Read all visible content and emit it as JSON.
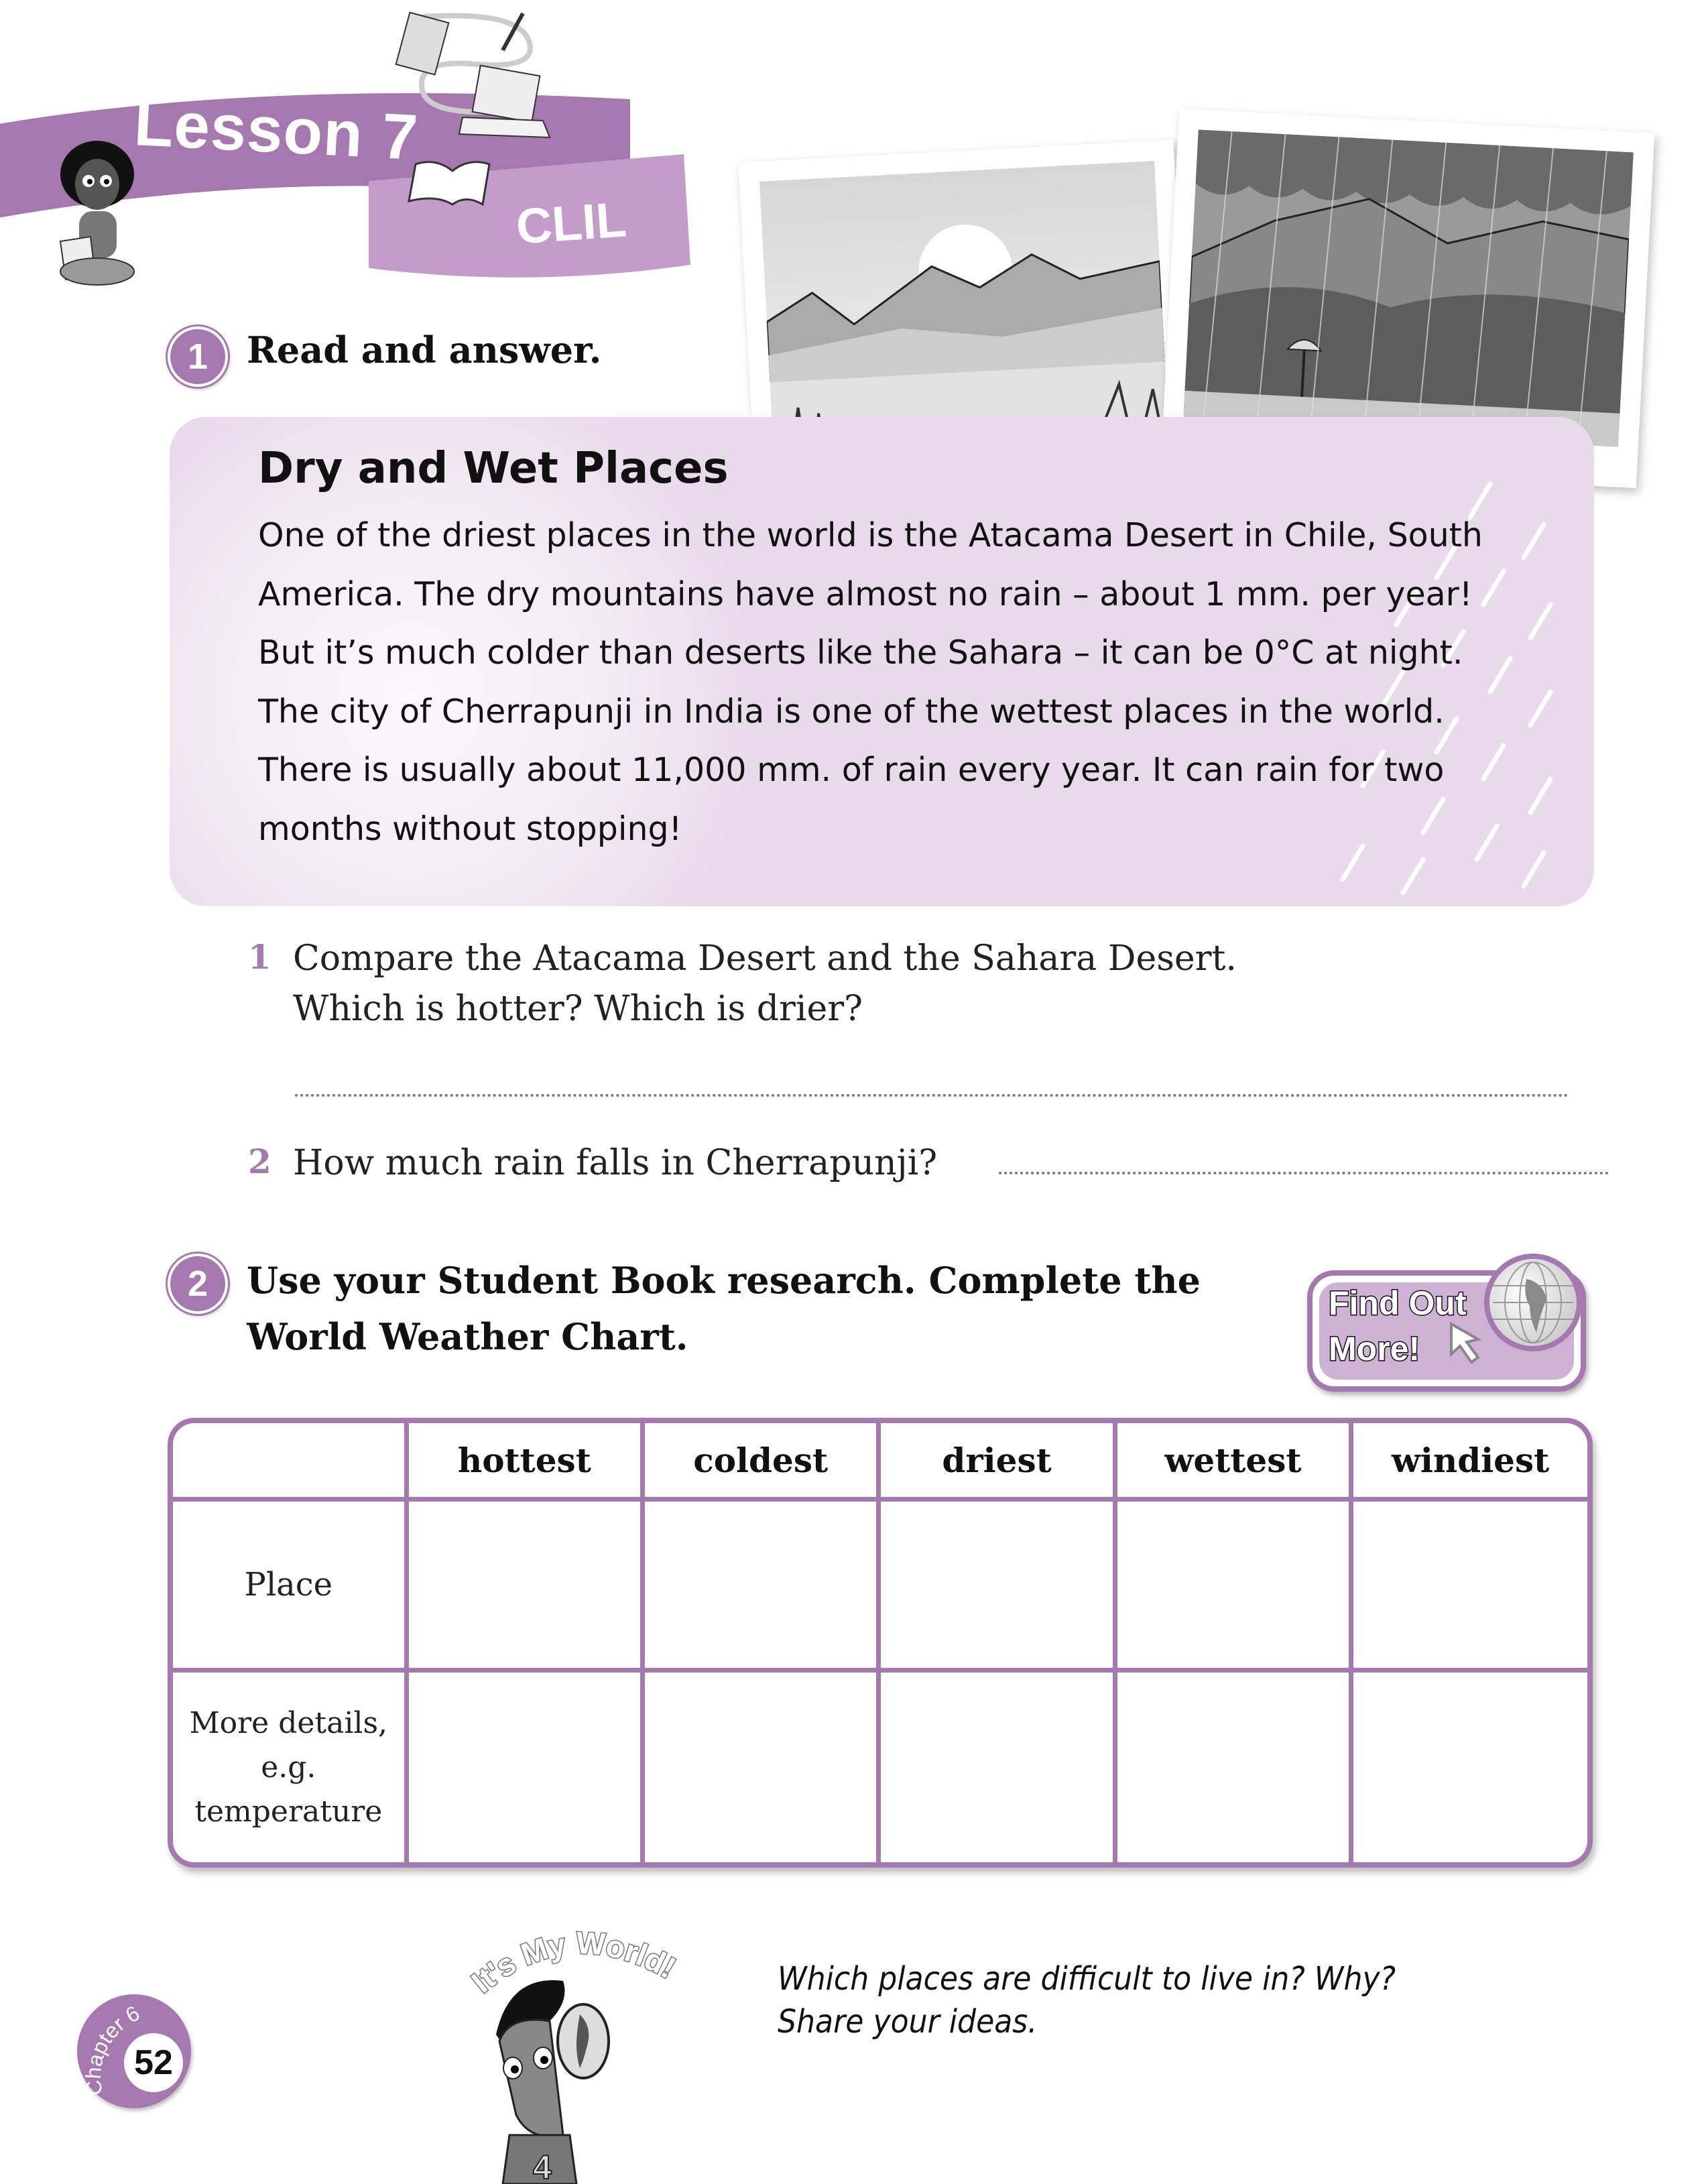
{
  "header": {
    "lesson_label": "Lesson 7",
    "section_label": "CLIL"
  },
  "exercise1": {
    "number": "1",
    "instruction": "Read and answer."
  },
  "reading": {
    "title": "Dry and Wet Places",
    "lines": [
      "One of the driest places in the world is the Atacama Desert in Chile, South",
      "America. The dry mountains have almost no rain – about 1 mm. per year!",
      "But it’s much colder than deserts like the Sahara – it can be 0°C at night.",
      "The city of Cherrapunji in India is one of the wettest places in the world.",
      "There is usually about 11,000 mm. of rain every year. It can rain for two",
      "months without stopping!"
    ]
  },
  "photos": [
    {
      "subject": "dry desert mountains"
    },
    {
      "subject": "rainy mountain forest with person under umbrella"
    }
  ],
  "questions": [
    {
      "number": "1",
      "lines": [
        "Compare the Atacama Desert and the Sahara Desert.",
        "Which is hotter? Which is drier?"
      ],
      "answer": ""
    },
    {
      "number": "2",
      "lines": [
        "How much rain falls in Cherrapunji?"
      ],
      "answer": ""
    }
  ],
  "exercise2": {
    "number": "2",
    "instruction_lines": [
      "Use your Student Book research. Complete the",
      "World Weather Chart."
    ]
  },
  "find_out_more": {
    "line1": "Find Out",
    "line2": "More!"
  },
  "weather_chart": {
    "columns": [
      "",
      "hottest",
      "coldest",
      "driest",
      "wettest",
      "windiest"
    ],
    "rows": [
      {
        "label_lines": [
          "Place"
        ],
        "cells": [
          "",
          "",
          "",
          "",
          ""
        ]
      },
      {
        "label_lines": [
          "More details,",
          "e.g.",
          "temperature"
        ],
        "cells": [
          "",
          "",
          "",
          "",
          ""
        ]
      }
    ]
  },
  "its_my_world": {
    "badge": "It's My World!",
    "prompt_lines": [
      "Which places are difficult to live in? Why?",
      "Share your ideas."
    ]
  },
  "page": {
    "chapter": "Chapter 6",
    "number": "52"
  },
  "colors": {
    "accent": "#a578b0",
    "accent_light": "#c39cc9",
    "box_bg": "#e7dae9"
  }
}
